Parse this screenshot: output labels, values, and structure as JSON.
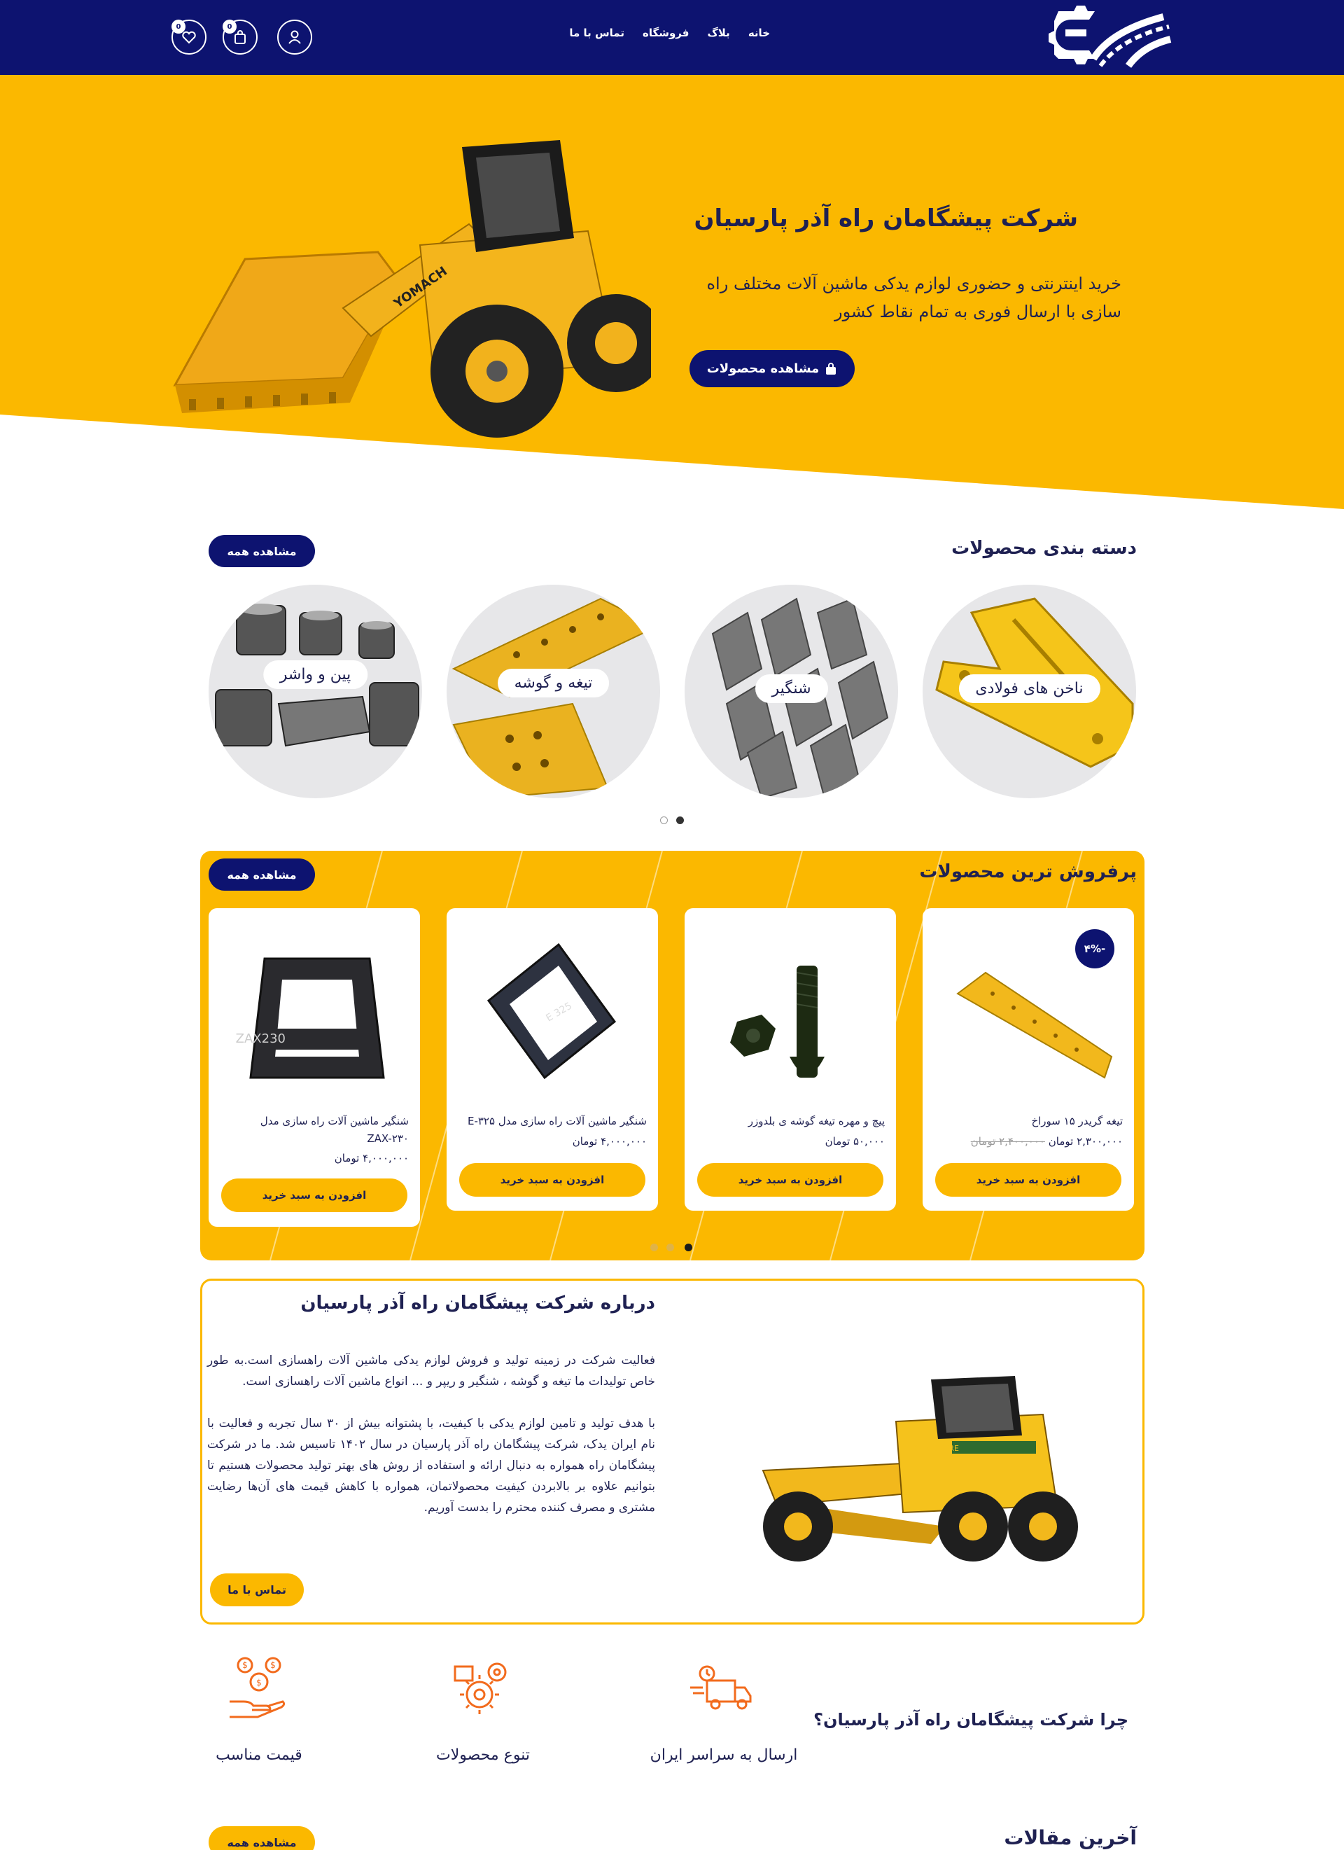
{
  "header": {
    "nav": [
      "خانه",
      "بلاگ",
      "فروشگاه",
      "تماس با ما"
    ],
    "cart_count": "0",
    "wishlist_count": "0"
  },
  "hero": {
    "title": "شرکت پیشگامان راه آذر پارسیان",
    "subtitle": "خرید اینترنتی و حضوری لوازم یدکی ماشین آلات مختلف راه سازی با ارسال فوری به تمام نقاط کشور",
    "button": "مشاهده محصولات",
    "image_caption": "YOMACH"
  },
  "categories": {
    "title": "دسته بندی محصولات",
    "see_all": "مشاهده همه",
    "items": [
      "ناخن های فولادی",
      "شنگیر",
      "تیغه و گوشه",
      "پین و واشر"
    ]
  },
  "bestsellers": {
    "title": "پرفروش ترین محصولات",
    "see_all": "مشاهده همه",
    "products": [
      {
        "name": "تیغه گریدر ۱۵ سوراخ",
        "old_price": "۲,۴۰۰,۰۰۰ تومان",
        "price": "۲,۳۰۰,۰۰۰ تومان",
        "discount": "-۴%",
        "button": "افزودن به سبد خرید"
      },
      {
        "name": "پیچ و مهره تیغه گوشه ی بلدوزر",
        "price": "۵۰,۰۰۰ تومان",
        "button": "افزودن به سبد خرید"
      },
      {
        "name": "شنگیر ماشین آلات راه سازی مدل E-۳۲۵",
        "price": "۴,۰۰۰,۰۰۰ تومان",
        "button": "افزودن به سبد خرید",
        "part_mark": "E 325"
      },
      {
        "name": "شنگیر ماشین آلات راه سازی مدل ZAX-۲۳۰",
        "price": "۴,۰۰۰,۰۰۰ تومان",
        "button": "افزودن به سبد خرید",
        "part_mark": "ZAX230"
      }
    ]
  },
  "about": {
    "title": "درباره شرکت پیشگامان راه آذر پارسیان",
    "p1": "فعالیت شرکت در زمینه تولید و فروش لوازم یدکی ماشین آلات راهسازی است.به طور خاص تولیدات ما تیغه و گوشه ، شنگیر و ریپر و ... انواع ماشین آلات راهسازی است.",
    "p2": "با هدف تولید و تامین لوازم یدکی با کیفیت، با پشتوانه بیش از ۳۰ سال تجربه و فعالیت با نام ایران یدک، شرکت پیشگامان راه آذر پارسیان در سال ۱۴۰۲ تاسیس شد. ما در شرکت پیشگامان راه همواره به دنبال ارائه و استفاده از روش های بهتر تولید محصولات هستیم تا بتوانیم علاوه بر بالابردن کیفیت محصولاتمان، همواره با کاهش قیمت های آن‌ها رضایت مشتری و مصرف کننده محترم را بدست آوریم.",
    "button": "تماس با ما",
    "image_caption": "JOHN DEERE"
  },
  "why": {
    "title": "چرا شرکت پیشگامان راه آذر پارسیان؟",
    "features": [
      {
        "label": "ارسال به سراسر ایران",
        "icon": "delivery-truck-icon"
      },
      {
        "label": "تنوع محصولات",
        "icon": "gears-icon"
      },
      {
        "label": "قیمت مناسب",
        "icon": "hand-money-icon"
      }
    ]
  },
  "articles": {
    "title": "آخرین مقالات",
    "see_all": "مشاهده همه"
  },
  "colors": {
    "navy": "#0d1370",
    "yellow": "#fbb800",
    "text": "#1f2152"
  }
}
